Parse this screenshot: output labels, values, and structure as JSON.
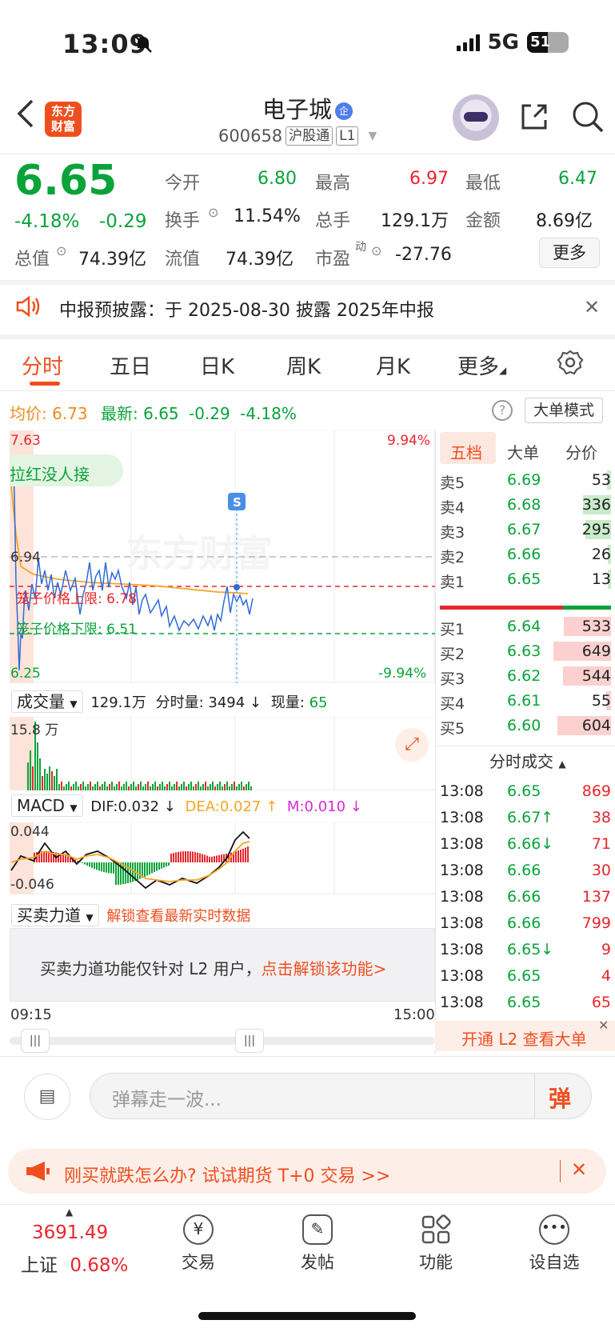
{
  "status": {
    "time": "13:09",
    "network": "5G",
    "battery": "51"
  },
  "header": {
    "logo_line1": "东方",
    "logo_line2": "财富",
    "name": "电子城",
    "enterprise_badge": "企",
    "code": "600658",
    "tag1": "沪股通",
    "tag2": "L1"
  },
  "quote": {
    "price": "6.65",
    "change_pct": "-4.18%",
    "change": "-0.29",
    "open_label": "今开",
    "open": "6.80",
    "high_label": "最高",
    "high": "6.97",
    "low_label": "最低",
    "low": "6.47",
    "turnover_label": "换手",
    "turnover": "11.54%",
    "volume_label": "总手",
    "volume": "129.1万",
    "amount_label": "金额",
    "amount": "8.69亿",
    "mktcap_label": "总值",
    "mktcap": "74.39亿",
    "float_label": "流值",
    "float": "74.39亿",
    "pe_label": "市盈",
    "pe_sup": "动",
    "pe": "-27.76",
    "more": "更多"
  },
  "notice": {
    "text": "中报预披露：于 2025-08-30 披露 2025年中报"
  },
  "tabs": [
    "分时",
    "五日",
    "日K",
    "周K",
    "月K",
    "更多"
  ],
  "chart_info": {
    "avg_label": "均价:",
    "avg": "6.73",
    "latest_label": "最新:",
    "latest": "6.65",
    "latest_chg": "-0.29",
    "latest_pct": "-4.18%",
    "big_order_mode": "大单模式"
  },
  "main_chart": {
    "y_top": "7.63",
    "y_mid": "6.94",
    "y_bottom": "6.25",
    "pct_top": "9.94%",
    "pct_bottom": "-9.94%",
    "overlay_text": "拉红没人接",
    "upper_limit_label": "笼子价格上限:",
    "upper_limit": "6.78",
    "lower_limit_label": "笼子价格下限:",
    "lower_limit": "6.51",
    "marker": "S",
    "watermark": "东方财富"
  },
  "volume_panel": {
    "selector": "成交量",
    "total": "129.1万",
    "tick_label": "分时量:",
    "tick_value": "3494 ↓",
    "now_label": "现量:",
    "now_value": "65",
    "max": "15.8 万"
  },
  "macd_panel": {
    "selector": "MACD",
    "dif": "DIF:0.032 ↓",
    "dea": "DEA:0.027 ↑",
    "m": "M:0.010 ↓",
    "top": "0.044",
    "bottom": "-0.046"
  },
  "force_panel": {
    "selector": "买卖力道",
    "unlock_hint": "解锁查看最新实时数据",
    "message": "买卖力道功能仅针对 L2 用户，",
    "unlock_link": "点击解锁该功能>"
  },
  "time_axis": {
    "start": "09:15",
    "end": "15:00"
  },
  "order_book": {
    "tabs": [
      "五档",
      "大单",
      "分价"
    ],
    "asks": [
      {
        "label": "卖5",
        "price": "6.69",
        "vol": "53",
        "bar": 0.04
      },
      {
        "label": "卖4",
        "price": "6.68",
        "vol": "336",
        "bar": 0.3
      },
      {
        "label": "卖3",
        "price": "6.67",
        "vol": "295",
        "bar": 0.27
      },
      {
        "label": "卖2",
        "price": "6.66",
        "vol": "26",
        "bar": 0.02
      },
      {
        "label": "卖1",
        "price": "6.65",
        "vol": "13",
        "bar": 0.01
      }
    ],
    "bids": [
      {
        "label": "买1",
        "price": "6.64",
        "vol": "533",
        "bar": 0.5
      },
      {
        "label": "买2",
        "price": "6.63",
        "vol": "649",
        "bar": 0.61
      },
      {
        "label": "买3",
        "price": "6.62",
        "vol": "544",
        "bar": 0.51
      },
      {
        "label": "买4",
        "price": "6.61",
        "vol": "55",
        "bar": 0.05
      },
      {
        "label": "买5",
        "price": "6.60",
        "vol": "604",
        "bar": 0.57
      }
    ],
    "trades_title": "分时成交",
    "trades": [
      {
        "time": "13:08",
        "price": "6.65",
        "vol": "869"
      },
      {
        "time": "13:08",
        "price": "6.67↑",
        "vol": "38"
      },
      {
        "time": "13:08",
        "price": "6.66↓",
        "vol": "71"
      },
      {
        "time": "13:08",
        "price": "6.66",
        "vol": "30"
      },
      {
        "time": "13:08",
        "price": "6.66",
        "vol": "137"
      },
      {
        "time": "13:08",
        "price": "6.66",
        "vol": "799"
      },
      {
        "time": "13:08",
        "price": "6.65↓",
        "vol": "9"
      },
      {
        "time": "13:08",
        "price": "6.65",
        "vol": "4"
      },
      {
        "time": "13:08",
        "price": "6.65",
        "vol": "65"
      }
    ],
    "l2_banner": "开通 L2 查看大单"
  },
  "danmu": {
    "placeholder": "弹幕走一波...",
    "send": "弹"
  },
  "promo": {
    "text": "刚买就跌怎么办? 试试期货 T+0 交易 >>"
  },
  "bottom_nav": {
    "index_value": "3691.49",
    "index_name": "上证",
    "index_pct": "0.68%",
    "items": [
      "交易",
      "发帖",
      "功能",
      "设自选"
    ]
  },
  "colors": {
    "accent": "#ef4f1f",
    "up": "#e8262c",
    "down": "#0aa33a",
    "avg": "#f5a623"
  }
}
